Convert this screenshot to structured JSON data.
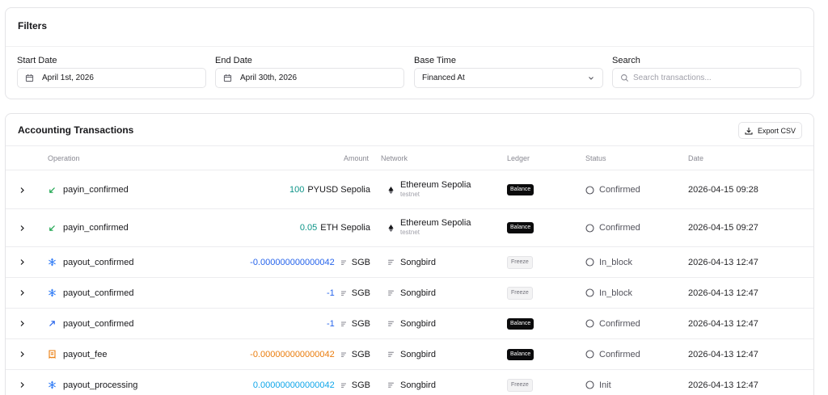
{
  "filters": {
    "title": "Filters",
    "start_date": {
      "label": "Start Date",
      "value": "April 1st, 2026"
    },
    "end_date": {
      "label": "End Date",
      "value": "April 30th, 2026"
    },
    "base_time": {
      "label": "Base Time",
      "value": "Financed At"
    },
    "search": {
      "label": "Search",
      "placeholder": "Search transactions..."
    }
  },
  "transactions": {
    "title": "Accounting Transactions",
    "export_label": "Export CSV",
    "columns": {
      "operation": "Operation",
      "amount": "Amount",
      "network": "Network",
      "ledger": "Ledger",
      "status": "Status",
      "date": "Date"
    },
    "rows": [
      {
        "operation": "payin_confirmed",
        "op_icon": "arrow-down-left-icon",
        "amount": "100",
        "amount_color": "#0d9488",
        "token": "PYUSD Sepolia",
        "network": "Ethereum Sepolia",
        "network_sub": "testnet",
        "ledger": "Balance",
        "status": "Confirmed",
        "date": "2026-04-15 09:28"
      },
      {
        "operation": "payin_confirmed",
        "op_icon": "arrow-down-left-icon",
        "amount": "0.05",
        "amount_color": "#0d9488",
        "token": "ETH Sepolia",
        "network": "Ethereum Sepolia",
        "network_sub": "testnet",
        "ledger": "Balance",
        "status": "Confirmed",
        "date": "2026-04-15 09:27"
      },
      {
        "operation": "payout_confirmed",
        "op_icon": "snowflake-icon",
        "amount": "-0.000000000000042",
        "amount_color": "#2563eb",
        "token": "SGB",
        "network": "Songbird",
        "network_sub": "",
        "ledger": "Freeze",
        "status": "In_block",
        "date": "2026-04-13 12:47"
      },
      {
        "operation": "payout_confirmed",
        "op_icon": "snowflake-icon",
        "amount": "-1",
        "amount_color": "#2563eb",
        "token": "SGB",
        "network": "Songbird",
        "network_sub": "",
        "ledger": "Freeze",
        "status": "In_block",
        "date": "2026-04-13 12:47"
      },
      {
        "operation": "payout_confirmed",
        "op_icon": "arrow-up-right-icon",
        "amount": "-1",
        "amount_color": "#2563eb",
        "token": "SGB",
        "network": "Songbird",
        "network_sub": "",
        "ledger": "Balance",
        "status": "Confirmed",
        "date": "2026-04-13 12:47"
      },
      {
        "operation": "payout_fee",
        "op_icon": "receipt-icon",
        "amount": "-0.000000000000042",
        "amount_color": "#ea7c0c",
        "token": "SGB",
        "network": "Songbird",
        "network_sub": "",
        "ledger": "Balance",
        "status": "Confirmed",
        "date": "2026-04-13 12:47"
      },
      {
        "operation": "payout_processing",
        "op_icon": "snowflake-icon",
        "amount": "0.000000000000042",
        "amount_color": "#0ea5e9",
        "token": "SGB",
        "network": "Songbird",
        "network_sub": "",
        "ledger": "Freeze",
        "status": "Init",
        "date": "2026-04-13 12:47"
      }
    ]
  }
}
